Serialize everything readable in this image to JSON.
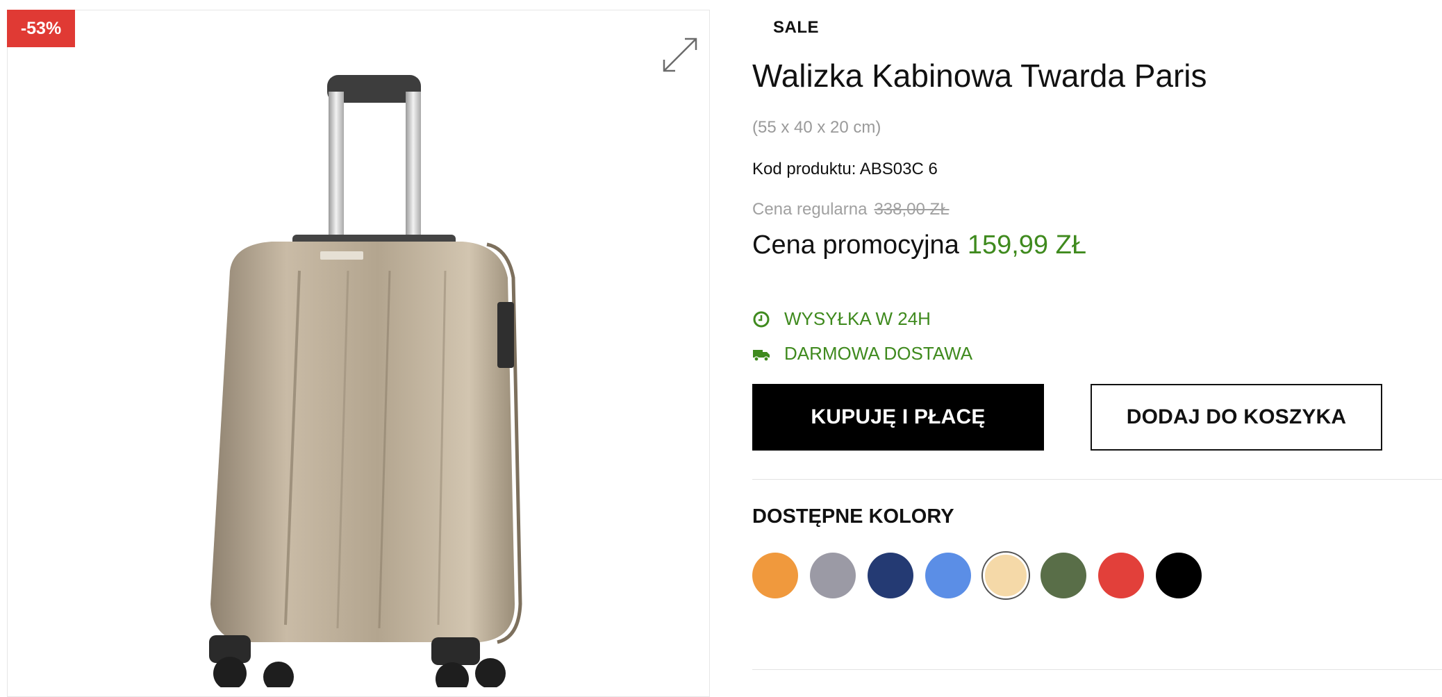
{
  "badge": {
    "discount": "-53%"
  },
  "gallery": {
    "zoom_icon": "expand-icon",
    "image_alt": "Walizka Kabinowa Twarda Paris"
  },
  "product": {
    "label": "SALE",
    "title": "Walizka Kabinowa Twarda Paris",
    "dimensions": "(55 x 40 x 20 cm)",
    "code": "Kod produktu: ABS03C 6"
  },
  "pricing": {
    "regular_label": "Cena regularna",
    "regular_price": "338,00 ZŁ",
    "promo_label": "Cena promocyjna",
    "promo_price": "159,99 ZŁ"
  },
  "features": [
    {
      "icon": "clock-icon",
      "text": "WYSYŁKA W 24H"
    },
    {
      "icon": "truck-icon",
      "text": "DARMOWA DOSTAWA"
    }
  ],
  "buttons": {
    "buy": "KUPUJĘ I PŁACĘ",
    "add_to_cart": "DODAJ DO KOSZYKA"
  },
  "colors": {
    "heading": "DOSTĘPNE KOLORY",
    "swatches": [
      {
        "color": "#f0993d",
        "selected": false
      },
      {
        "color": "#9b9aa5",
        "selected": false
      },
      {
        "color": "#243a73",
        "selected": false
      },
      {
        "color": "#5b8ee6",
        "selected": false
      },
      {
        "color": "#f5d9a8",
        "selected": true
      },
      {
        "color": "#596e48",
        "selected": false
      },
      {
        "color": "#e2403a",
        "selected": false
      },
      {
        "color": "#000000",
        "selected": false
      }
    ]
  },
  "theme": {
    "accent_green": "#3f8a1e",
    "badge_red": "#e03a34"
  }
}
